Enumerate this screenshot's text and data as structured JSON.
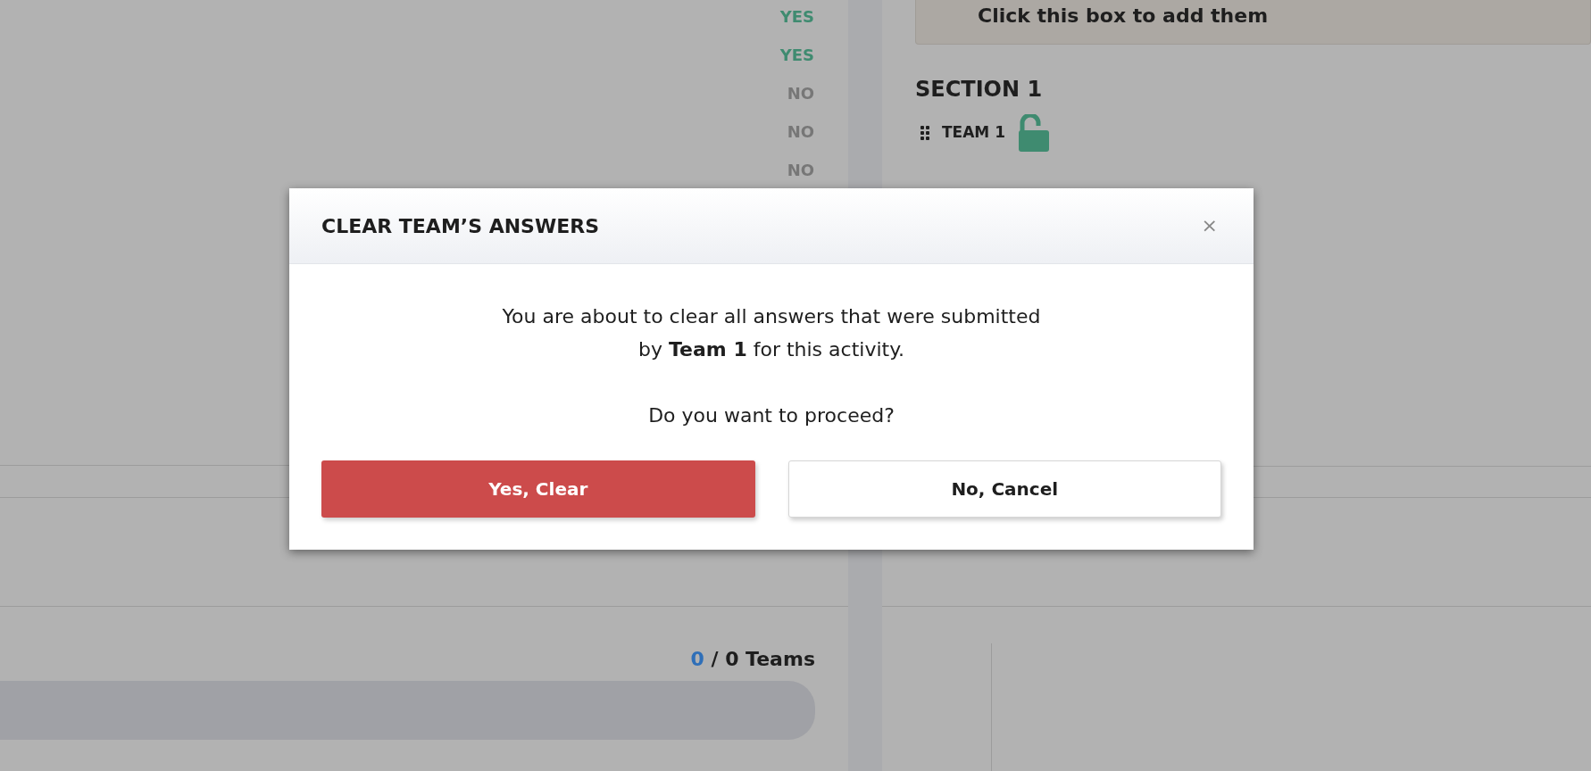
{
  "answers": [
    {
      "label": "YES",
      "kind": "yes"
    },
    {
      "label": "YES",
      "kind": "yes"
    },
    {
      "label": "NO",
      "kind": "no"
    },
    {
      "label": "NO",
      "kind": "no"
    },
    {
      "label": "NO",
      "kind": "no"
    }
  ],
  "add_box": {
    "text": "Click this box to add them"
  },
  "section": {
    "title": "SECTION 1",
    "teams": [
      {
        "name": "TEAM 1",
        "locked": false
      }
    ]
  },
  "progress": {
    "submitted": "0",
    "total": "/ 0 Teams",
    "level": 0
  },
  "modal": {
    "title": "CLEAR TEAM’S ANSWERS",
    "close": "×",
    "message": "You are about to clear all answers that were submitted\nby **Team 1** for this activity.",
    "question": "Do you want to proceed?",
    "buttons": [
      {
        "label": "Yes, Clear",
        "kind": "danger"
      },
      {
        "label": "No, Cancel",
        "kind": "secondary"
      }
    ]
  }
}
